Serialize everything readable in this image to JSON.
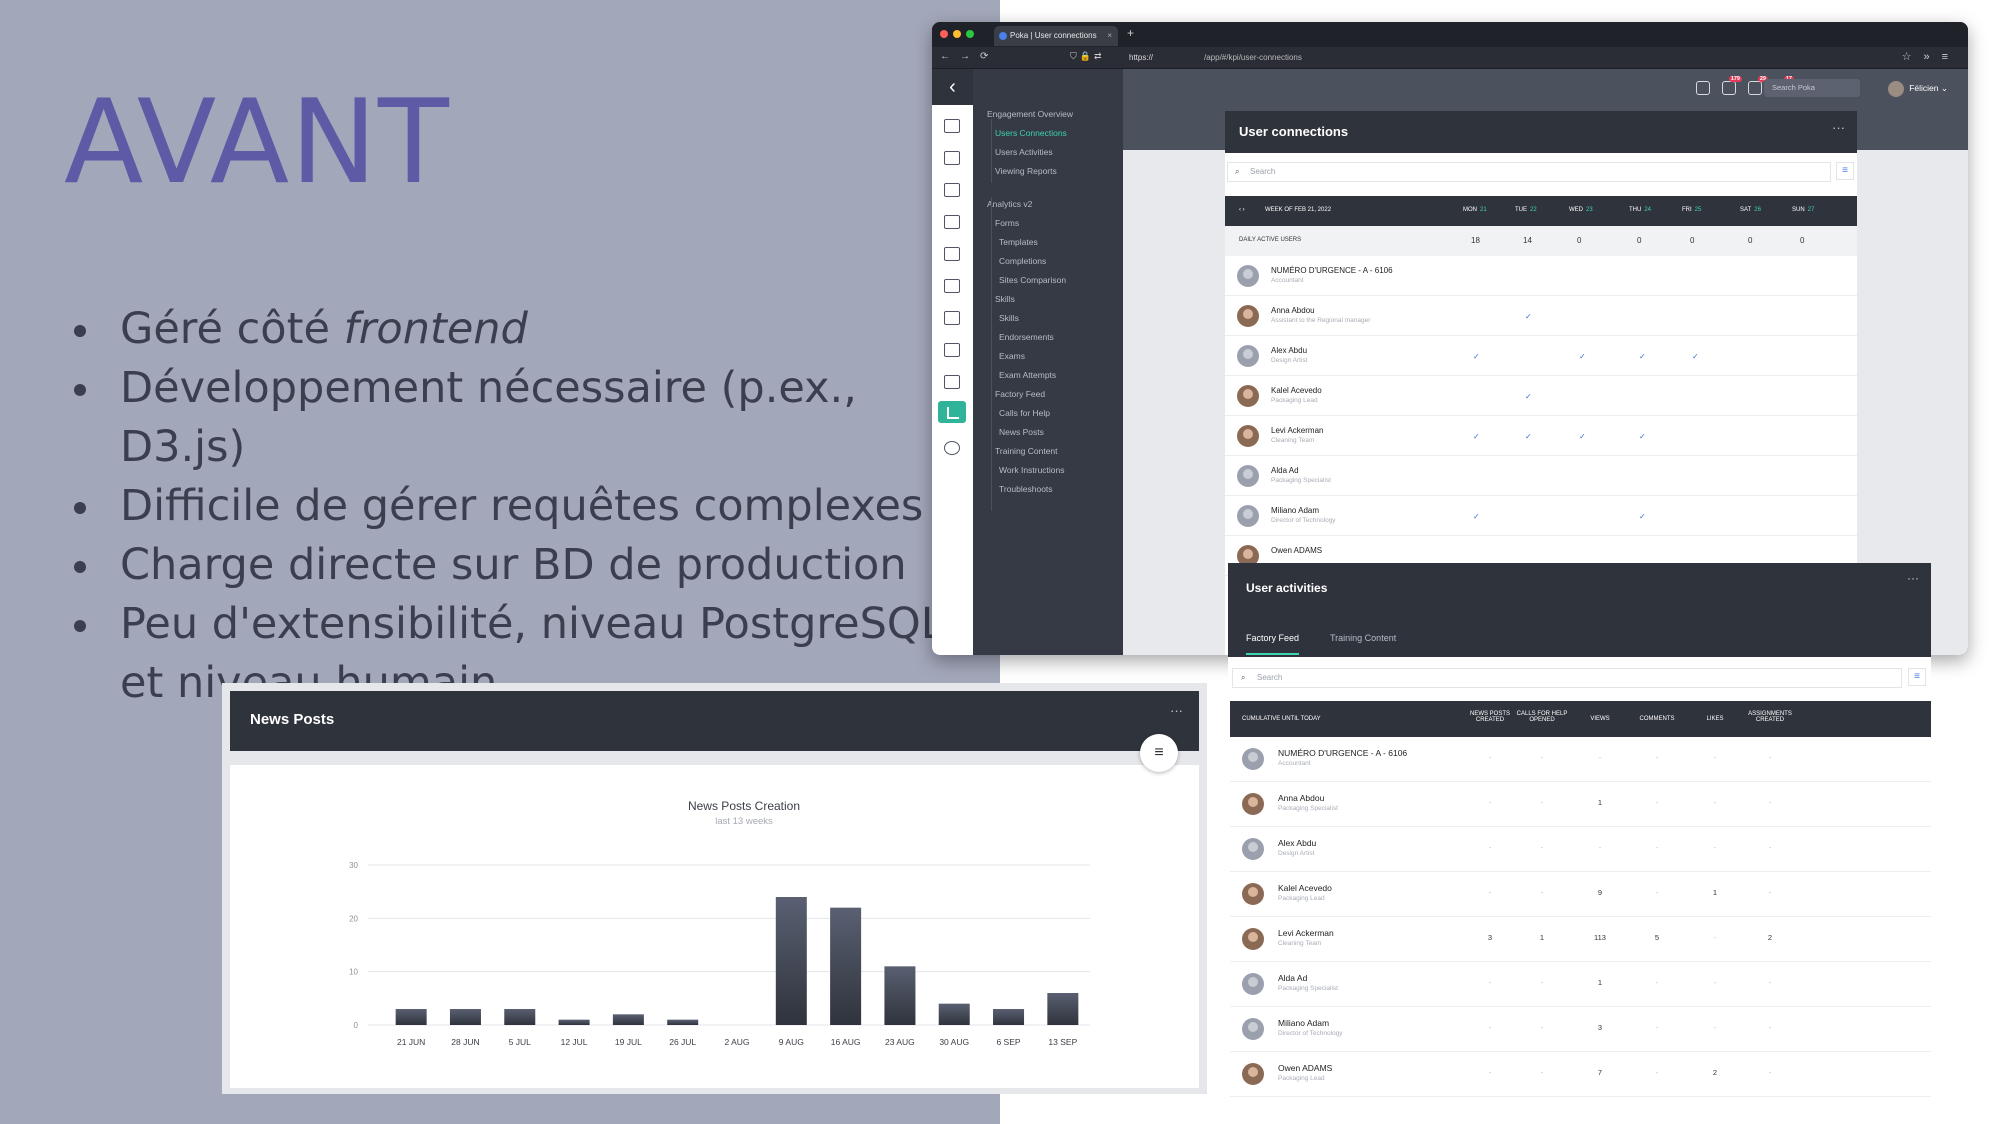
{
  "slide": {
    "title": "AVANT",
    "bullets": [
      {
        "pre": "Géré côté ",
        "em": "frontend"
      },
      {
        "pre": "Développement nécessaire (p.ex., D3.js)",
        "em": ""
      },
      {
        "pre": "Difficile de gérer requêtes complexes",
        "em": ""
      },
      {
        "pre": "Charge directe sur BD de production",
        "em": ""
      },
      {
        "pre": "Peu d'extensibilité, niveau PostgreSQL et niveau humain",
        "em": ""
      }
    ]
  },
  "browser": {
    "tab_title": "Poka | User connections",
    "url_scheme": "https://",
    "url_path": "/app/#/kpi/user-connections"
  },
  "topbar": {
    "badges": [
      "179",
      "29",
      "17"
    ],
    "search_placeholder": "Search Poka",
    "user_name": "Félicien"
  },
  "nav": {
    "items": [
      {
        "label": "Engagement Overview",
        "level": 0,
        "active": false
      },
      {
        "label": "Users Connections",
        "level": 1,
        "active": true
      },
      {
        "label": "Users Activities",
        "level": 1,
        "active": false
      },
      {
        "label": "Viewing Reports",
        "level": 1,
        "active": false
      },
      {
        "label": "Analytics v2",
        "level": 0,
        "active": false
      },
      {
        "label": "Forms",
        "level": 1,
        "active": false
      },
      {
        "label": "Templates",
        "level": 2,
        "active": false
      },
      {
        "label": "Completions",
        "level": 2,
        "active": false
      },
      {
        "label": "Sites Comparison",
        "level": 2,
        "active": false
      },
      {
        "label": "Skills",
        "level": 1,
        "active": false
      },
      {
        "label": "Skills",
        "level": 2,
        "active": false
      },
      {
        "label": "Endorsements",
        "level": 2,
        "active": false
      },
      {
        "label": "Exams",
        "level": 2,
        "active": false
      },
      {
        "label": "Exam Attempts",
        "level": 2,
        "active": false
      },
      {
        "label": "Factory Feed",
        "level": 1,
        "active": false
      },
      {
        "label": "Calls for Help",
        "level": 2,
        "active": false
      },
      {
        "label": "News Posts",
        "level": 2,
        "active": false
      },
      {
        "label": "Training Content",
        "level": 1,
        "active": false
      },
      {
        "label": "Work Instructions",
        "level": 2,
        "active": false
      },
      {
        "label": "Troubleshoots",
        "level": 2,
        "active": false
      }
    ]
  },
  "user_connections": {
    "title": "User connections",
    "more": "···",
    "search_placeholder": "Search",
    "week_label": "WEEK OF FEB 21, 2022",
    "days": [
      {
        "day": "MON",
        "date": "21"
      },
      {
        "day": "TUE",
        "date": "22"
      },
      {
        "day": "WED",
        "date": "23"
      },
      {
        "day": "THU",
        "date": "24"
      },
      {
        "day": "FRI",
        "date": "25"
      },
      {
        "day": "SAT",
        "date": "26"
      },
      {
        "day": "SUN",
        "date": "27"
      }
    ],
    "dau_label": "DAILY ACTIVE USERS",
    "dau_values": [
      "18",
      "14",
      "0",
      "0",
      "0",
      "0",
      "0"
    ],
    "rows": [
      {
        "name": "NUMÉRO D'URGENCE - A - 6106",
        "role": "Accountant",
        "photo": false,
        "checks": [
          false,
          false,
          false,
          false,
          false,
          false,
          false
        ]
      },
      {
        "name": "Anna Abdou",
        "role": "Assistant to the Regional manager",
        "photo": true,
        "checks": [
          false,
          true,
          false,
          false,
          false,
          false,
          false
        ]
      },
      {
        "name": "Alex Abdu",
        "role": "Design Artist",
        "photo": false,
        "checks": [
          true,
          false,
          true,
          true,
          true,
          false,
          false
        ]
      },
      {
        "name": "Kalel Acevedo",
        "role": "Packaging Lead",
        "photo": true,
        "checks": [
          false,
          true,
          false,
          false,
          false,
          false,
          false
        ]
      },
      {
        "name": "Levi Ackerman",
        "role": "Cleaning Team",
        "photo": true,
        "checks": [
          true,
          true,
          true,
          true,
          false,
          false,
          false
        ]
      },
      {
        "name": "Alda Ad",
        "role": "Packaging Specialist",
        "photo": false,
        "checks": [
          false,
          false,
          false,
          false,
          false,
          false,
          false
        ]
      },
      {
        "name": "Miliano Adam",
        "role": "Director of Technology",
        "photo": false,
        "checks": [
          true,
          false,
          false,
          true,
          false,
          false,
          false
        ]
      },
      {
        "name": "Owen ADAMS",
        "role": "",
        "photo": true,
        "checks": [
          false,
          false,
          false,
          false,
          false,
          false,
          false
        ]
      }
    ],
    "check_glyph": "✓"
  },
  "user_activities": {
    "title": "User activities",
    "more": "···",
    "tabs": [
      {
        "label": "Factory Feed",
        "active": true
      },
      {
        "label": "Training Content",
        "active": false
      }
    ],
    "search_placeholder": "Search",
    "first_col": "CUMULATIVE UNTIL TODAY",
    "columns": [
      [
        "NEWS POSTS",
        "CREATED"
      ],
      [
        "CALLS FOR HELP",
        "OPENED"
      ],
      [
        "VIEWS",
        ""
      ],
      [
        "COMMENTS",
        ""
      ],
      [
        "LIKES",
        ""
      ],
      [
        "ASSIGNMENTS",
        "CREATED"
      ]
    ],
    "rows": [
      {
        "name": "NUMÉRO D'URGENCE - A - 6106",
        "role": "Accountant",
        "photo": false,
        "values": [
          "-",
          "-",
          "-",
          "-",
          "-",
          "-"
        ]
      },
      {
        "name": "Anna Abdou",
        "role": "Packaging Specialist",
        "photo": true,
        "values": [
          "-",
          "-",
          "1",
          "-",
          "-",
          "-"
        ]
      },
      {
        "name": "Alex Abdu",
        "role": "Design Artist",
        "photo": false,
        "values": [
          "-",
          "-",
          "-",
          "-",
          "-",
          "-"
        ]
      },
      {
        "name": "Kalel Acevedo",
        "role": "Packaging Lead",
        "photo": true,
        "values": [
          "-",
          "-",
          "9",
          "-",
          "1",
          "-"
        ]
      },
      {
        "name": "Levi Ackerman",
        "role": "Cleaning Team",
        "photo": true,
        "values": [
          "3",
          "1",
          "113",
          "5",
          "-",
          "2"
        ]
      },
      {
        "name": "Alda Ad",
        "role": "Packaging Specialist",
        "photo": false,
        "values": [
          "-",
          "-",
          "1",
          "-",
          "-",
          "-"
        ]
      },
      {
        "name": "Miliano Adam",
        "role": "Director of Technology",
        "photo": false,
        "values": [
          "-",
          "-",
          "3",
          "-",
          "-",
          "-"
        ]
      },
      {
        "name": "Owen ADAMS",
        "role": "Packaging Lead",
        "photo": true,
        "values": [
          "-",
          "-",
          "7",
          "-",
          "2",
          "-"
        ]
      }
    ]
  },
  "news_posts": {
    "title": "News Posts",
    "more": "···"
  },
  "chart_data": {
    "type": "bar",
    "title": "News Posts Creation",
    "subtitle": "last 13 weeks",
    "categories": [
      "21 JUN",
      "28 JUN",
      "5 JUL",
      "12 JUL",
      "19 JUL",
      "26 JUL",
      "2 AUG",
      "9 AUG",
      "16 AUG",
      "23 AUG",
      "30 AUG",
      "6 SEP",
      "13 SEP"
    ],
    "values": [
      3,
      3,
      3,
      1,
      2,
      1,
      0,
      24,
      22,
      11,
      4,
      3,
      6
    ],
    "yticks": [
      0,
      10,
      20,
      30
    ],
    "ylim": [
      0,
      30
    ],
    "grid": true,
    "colors": {
      "bar_top": "#5a6072",
      "bar_bottom": "#2f333c"
    }
  },
  "colors": {
    "accent": "#3fd3b0",
    "title_purple": "#5e5aa6",
    "dark": "#2f333c",
    "link_blue": "#3b6fd6"
  }
}
